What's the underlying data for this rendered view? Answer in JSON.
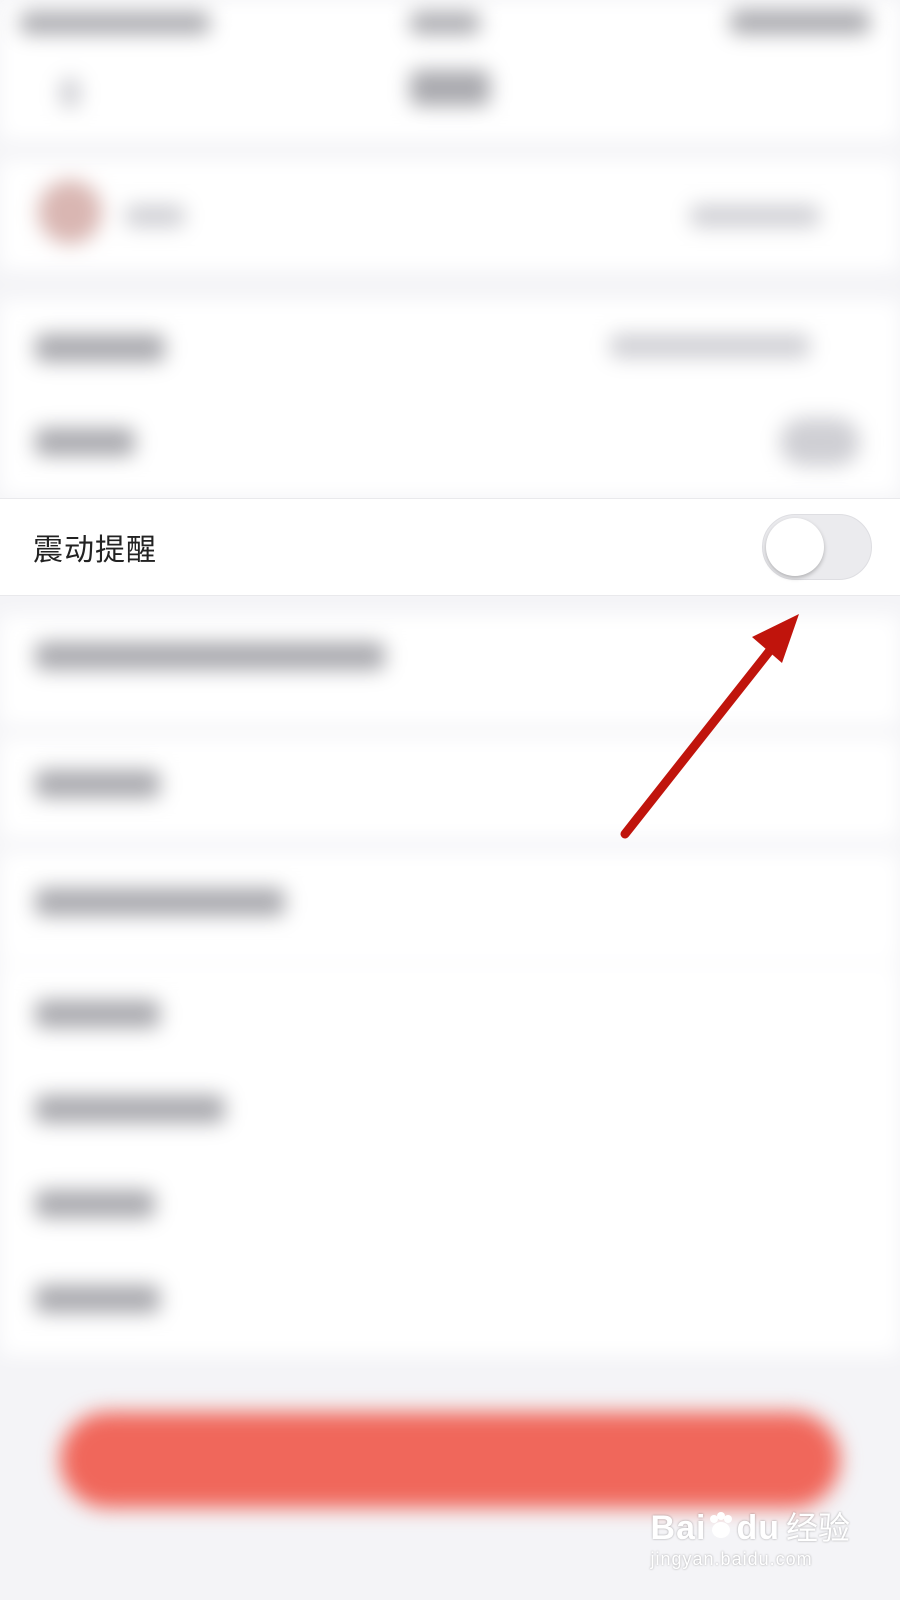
{
  "vibration_row": {
    "label": "震动提醒",
    "toggle_on": false
  },
  "annotation": {
    "color": "#c0140c"
  },
  "colors": {
    "toggle_off_track": "#ebebee",
    "primary_button": "#f0675b"
  },
  "watermark": {
    "brand_left": "Bai",
    "brand_right": "du",
    "product": "经验",
    "url": "jingyan.baidu.com"
  }
}
